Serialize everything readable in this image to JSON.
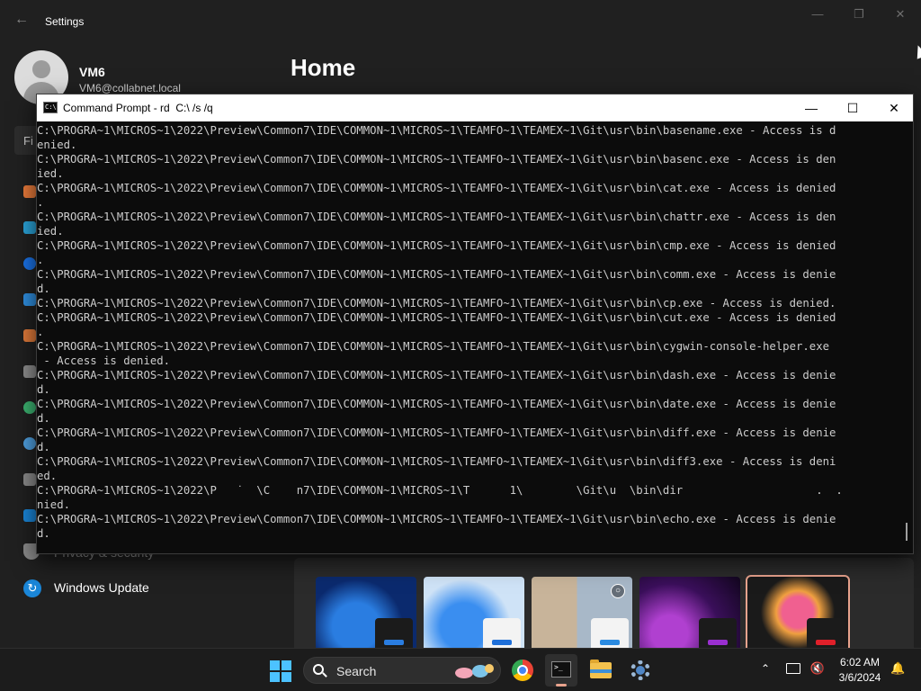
{
  "settings": {
    "window_title": "Settings",
    "user": {
      "name": "VM6",
      "email": "VM6@collabnet.local"
    },
    "page_title": "Home",
    "find_placeholder": "Fi",
    "nav": {
      "privacy_label": "Privacy & security",
      "update_label": "Windows Update"
    },
    "sidebar_icon_colors": [
      "#e87a3a",
      "#2aa3d8",
      "#1a73e8",
      "#2f8fe0",
      "#e07a3a",
      "#8c8c8c",
      "#3cb371",
      "#4fa0e0",
      "#8a8a8a",
      "#1a86d8"
    ]
  },
  "cmd": {
    "title": "Command Prompt - rd  C:\\ /s /q",
    "lines": [
      "C:\\PROGRA~1\\MICROS~1\\2022\\Preview\\Common7\\IDE\\COMMON~1\\MICROS~1\\TEAMFO~1\\TEAMEX~1\\Git\\usr\\bin\\basename.exe - Access is d",
      "enied.",
      "C:\\PROGRA~1\\MICROS~1\\2022\\Preview\\Common7\\IDE\\COMMON~1\\MICROS~1\\TEAMFO~1\\TEAMEX~1\\Git\\usr\\bin\\basenc.exe - Access is den",
      "ied.",
      "C:\\PROGRA~1\\MICROS~1\\2022\\Preview\\Common7\\IDE\\COMMON~1\\MICROS~1\\TEAMFO~1\\TEAMEX~1\\Git\\usr\\bin\\cat.exe - Access is denied",
      ".",
      "C:\\PROGRA~1\\MICROS~1\\2022\\Preview\\Common7\\IDE\\COMMON~1\\MICROS~1\\TEAMFO~1\\TEAMEX~1\\Git\\usr\\bin\\chattr.exe - Access is den",
      "ied.",
      "C:\\PROGRA~1\\MICROS~1\\2022\\Preview\\Common7\\IDE\\COMMON~1\\MICROS~1\\TEAMFO~1\\TEAMEX~1\\Git\\usr\\bin\\cmp.exe - Access is denied",
      ".",
      "C:\\PROGRA~1\\MICROS~1\\2022\\Preview\\Common7\\IDE\\COMMON~1\\MICROS~1\\TEAMFO~1\\TEAMEX~1\\Git\\usr\\bin\\comm.exe - Access is denie",
      "d.",
      "C:\\PROGRA~1\\MICROS~1\\2022\\Preview\\Common7\\IDE\\COMMON~1\\MICROS~1\\TEAMFO~1\\TEAMEX~1\\Git\\usr\\bin\\cp.exe - Access is denied.",
      "C:\\PROGRA~1\\MICROS~1\\2022\\Preview\\Common7\\IDE\\COMMON~1\\MICROS~1\\TEAMFO~1\\TEAMEX~1\\Git\\usr\\bin\\cut.exe - Access is denied",
      ".",
      "C:\\PROGRA~1\\MICROS~1\\2022\\Preview\\Common7\\IDE\\COMMON~1\\MICROS~1\\TEAMFO~1\\TEAMEX~1\\Git\\usr\\bin\\cygwin-console-helper.exe",
      " - Access is denied.",
      "C:\\PROGRA~1\\MICROS~1\\2022\\Preview\\Common7\\IDE\\COMMON~1\\MICROS~1\\TEAMFO~1\\TEAMEX~1\\Git\\usr\\bin\\dash.exe - Access is denie",
      "d.",
      "C:\\PROGRA~1\\MICROS~1\\2022\\Preview\\Common7\\IDE\\COMMON~1\\MICROS~1\\TEAMFO~1\\TEAMEX~1\\Git\\usr\\bin\\date.exe - Access is denie",
      "d.",
      "C:\\PROGRA~1\\MICROS~1\\2022\\Preview\\Common7\\IDE\\COMMON~1\\MICROS~1\\TEAMFO~1\\TEAMEX~1\\Git\\usr\\bin\\diff.exe - Access is denie",
      "d.",
      "C:\\PROGRA~1\\MICROS~1\\2022\\Preview\\Common7\\IDE\\COMMON~1\\MICROS~1\\TEAMFO~1\\TEAMEX~1\\Git\\usr\\bin\\diff3.exe - Access is deni",
      "ed.",
      "C:\\PROGRA~1\\MICROS~1\\2022\\P   ˙  \\C    n7\\IDE\\COMMON~1\\MICROS~1\\T      1\\        \\Git\\u  \\bin\\dir                    .  .",
      "nied.",
      "C:\\PROGRA~1\\MICROS~1\\2022\\Preview\\Common7\\IDE\\COMMON~1\\MICROS~1\\TEAMFO~1\\TEAMEX~1\\Git\\usr\\bin\\echo.exe - Access is denie",
      "d."
    ]
  },
  "themes": {
    "colors": [
      {
        "bg": "#0b2a6e",
        "accent": "#2a7de1"
      },
      {
        "bg": "#cfe3f7",
        "accent": "#1e6fd9"
      },
      {
        "bg": "#a8b8c8",
        "accent": "#2a8ae0"
      },
      {
        "bg": "#3a0f5a",
        "accent": "#9a2fd0"
      },
      {
        "bg": "#1a1a1a",
        "accent": "#e0202a"
      }
    ]
  },
  "taskbar": {
    "search_label": "Search",
    "time": "6:02 AM",
    "date": "3/6/2024",
    "accent": "#4cc2ff"
  }
}
